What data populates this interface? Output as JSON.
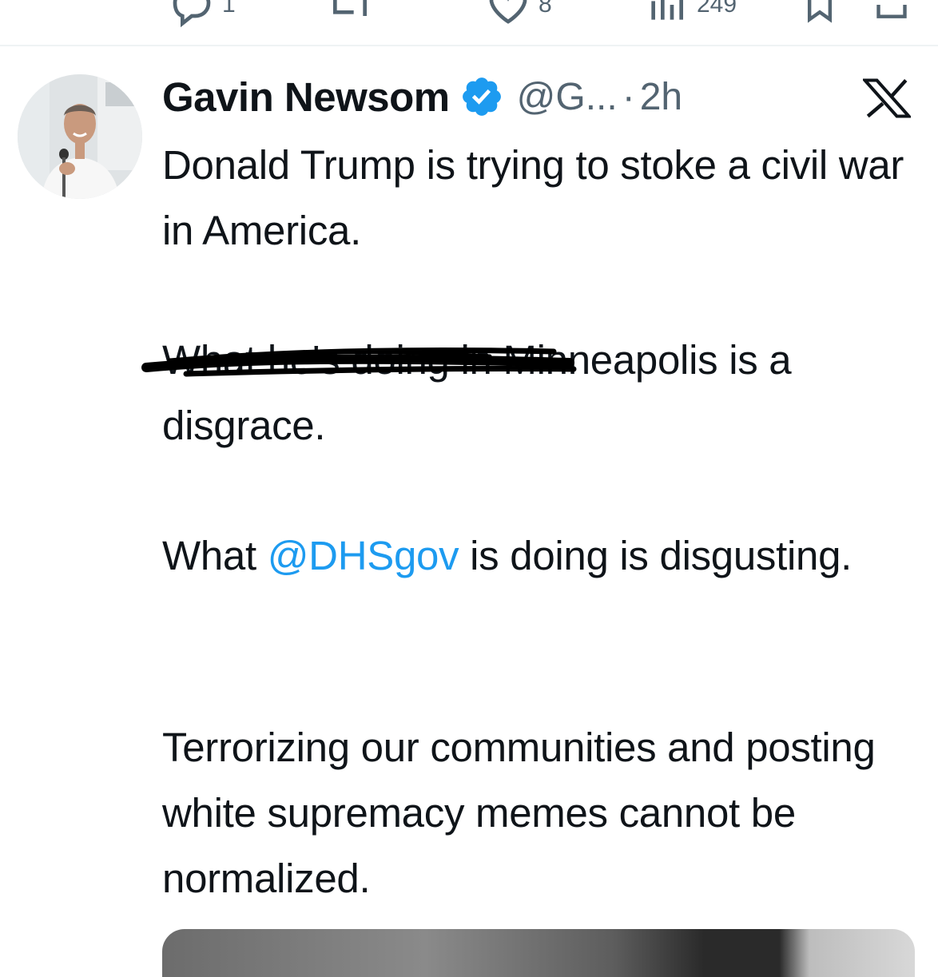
{
  "previous_tweet_actions": [
    {
      "icon": "reply-icon",
      "count": "1"
    },
    {
      "icon": "retweet-icon",
      "count": ""
    },
    {
      "icon": "like-icon",
      "count": "8"
    },
    {
      "icon": "views-icon",
      "count": "249"
    },
    {
      "icon": "bookmark-icon",
      "count": ""
    },
    {
      "icon": "share-icon",
      "count": ""
    }
  ],
  "tweet": {
    "author_name": "Gavin Newsom",
    "verified": true,
    "handle": "@G...",
    "separator": "·",
    "time": "2h",
    "source_logo": "x-logo-icon",
    "paragraph_1": "Donald Trump is trying to stoke a civil war in America.",
    "paragraph_2_struck": "What he's doing in",
    "paragraph_2_rest": " Minneapolis is a disgrace.",
    "paragraph_3_start": "What ",
    "paragraph_3_mention": "@DHSgov",
    "paragraph_3_end": " is doing is disgusting.",
    "paragraph_4": "Terrorizing our communities and posting white supremacy memes cannot be normalized."
  },
  "colors": {
    "text": "#0f1419",
    "secondary": "#536471",
    "mention": "#1d9bf0",
    "verified": "#1d9bf0",
    "divider": "#eff3f4"
  }
}
